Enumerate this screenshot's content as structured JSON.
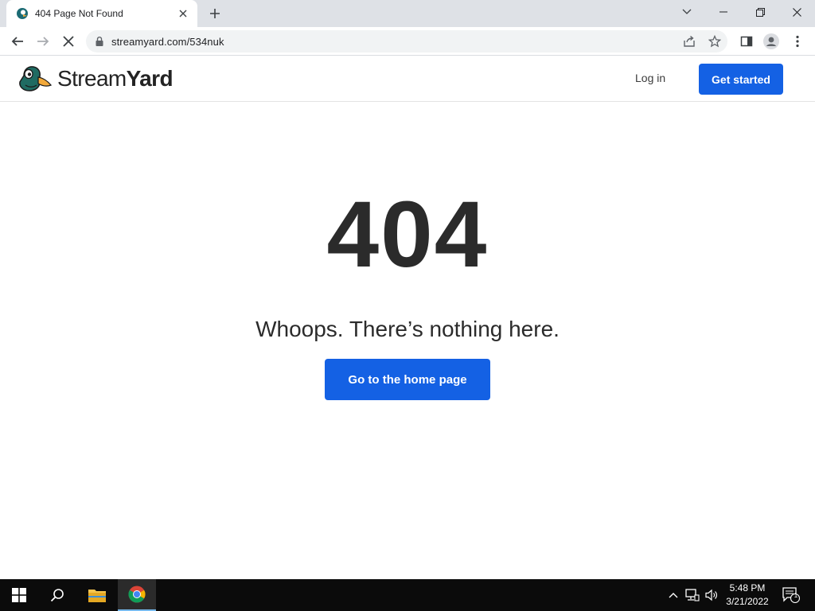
{
  "browser": {
    "tab": {
      "title": "404 Page Not Found",
      "favicon": "streamyard-favicon-icon"
    },
    "url": "streamyard.com/534nuk",
    "accent": "#1a73e8"
  },
  "site": {
    "brand": {
      "first": "Stream",
      "second": "Yard",
      "logo": "duck-logo-icon"
    },
    "nav": {
      "login": "Log in",
      "cta": "Get started"
    },
    "brand_color": "#1461e4"
  },
  "content": {
    "code": "404",
    "message": "Whoops. There’s nothing here.",
    "button": "Go to the home page"
  },
  "taskbar": {
    "time": "5:48 PM",
    "date": "3/21/2022",
    "notifications": "1"
  }
}
